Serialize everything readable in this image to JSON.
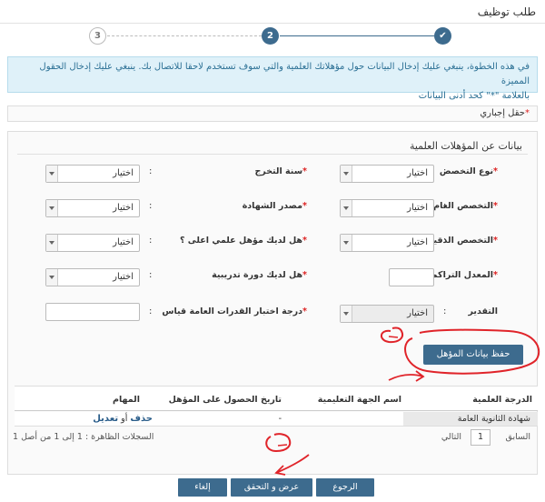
{
  "page_title": "طلب توظيف",
  "steps": [
    "3",
    "2",
    "✔"
  ],
  "notice_line1": "في هذه الخطوة، ينبغي عليك إدخال البيانات حول مؤهلاتك العلمية والتي سوف تستخدم لاحقا للاتصال بك. ينبغي عليك إدخال الحقول المميزة",
  "notice_line2": "بالعلامة \"*\" كحد أدنى البيانات",
  "required_text": "حقل إجباري",
  "panel_title": "بيانات عن المؤهلات العلمية",
  "colon": ":",
  "select_placeholder": "اختيار",
  "fields": {
    "specialization_type": "نوع التخصص",
    "graduation_year": "سنة التخرج",
    "general_specialization": "التخصص العام",
    "certificate_source": "مصدر الشهادة",
    "precise_specialization": "التخصص الدقيق",
    "higher_qualification": "هل لديك مؤهل علمي اعلى ؟",
    "gpa": "المعدل التراكمي",
    "training_course": "هل لديك دورة تدريبية",
    "grade": "التقدير",
    "aptitude_score": "درجة اختبار القدرات العامة قياس"
  },
  "save_button": "حفظ بيانات المؤهل",
  "table": {
    "headers": [
      "الدرجة العلمية",
      "اسم الجهة التعليمية",
      "تاريخ الحصول على المؤهل",
      "المهام"
    ],
    "rows": [
      {
        "degree": "شهادة الثانوية العامة",
        "institution": "",
        "date": "-",
        "delete": "حذف",
        "or": "أو",
        "edit": "تعديل"
      }
    ]
  },
  "pager": {
    "previous": "السابق",
    "page": "1",
    "next": "التالي",
    "records": "السجلات الظاهرة : 1 إلى 1 من أصل 1"
  },
  "footer": {
    "back": "الرجوع",
    "review": "عرض و التحقق",
    "cancel": "إلغاء"
  },
  "colors": {
    "primary": "#3d6b8e",
    "notice_bg": "#dff1f9",
    "annotation": "#e0242a"
  }
}
